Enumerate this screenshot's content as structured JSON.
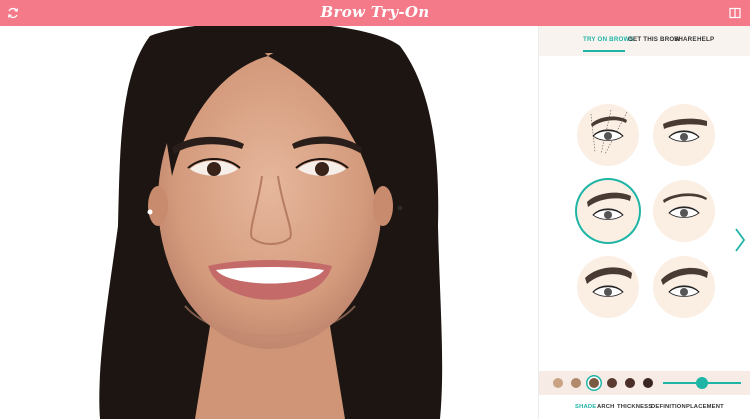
{
  "header": {
    "title": "Brow Try-On",
    "left_icon": "rotate-icon",
    "right_icon": "split-view-icon",
    "background": "#f47a8a"
  },
  "photo": {
    "description_icon": "model-face-photo"
  },
  "tabs": [
    {
      "label": "TRY ON BROWS",
      "active": true
    },
    {
      "label": "GET THIS BROW",
      "active": false
    },
    {
      "label": "SHARE",
      "active": false
    },
    {
      "label": "HELP",
      "active": false
    }
  ],
  "brow_styles": {
    "selected_index": 2,
    "next_icon": "chevron-right-icon"
  },
  "shades": {
    "colors": [
      "#c9a383",
      "#b08a6a",
      "#7a5a42",
      "#5a3b30",
      "#4a2f28",
      "#3a2622"
    ],
    "selected_index": 2,
    "slider_value": 0.5
  },
  "adjust_tabs": [
    {
      "label": "SHADE",
      "active": true
    },
    {
      "label": "ARCH",
      "active": false
    },
    {
      "label": "THICKNESS",
      "active": false
    },
    {
      "label": "DEFINITION",
      "active": false
    },
    {
      "label": "PLACEMENT",
      "active": false
    }
  ],
  "colors": {
    "accent": "#1fb5a6",
    "panel_bg": "#f8f3ef"
  }
}
